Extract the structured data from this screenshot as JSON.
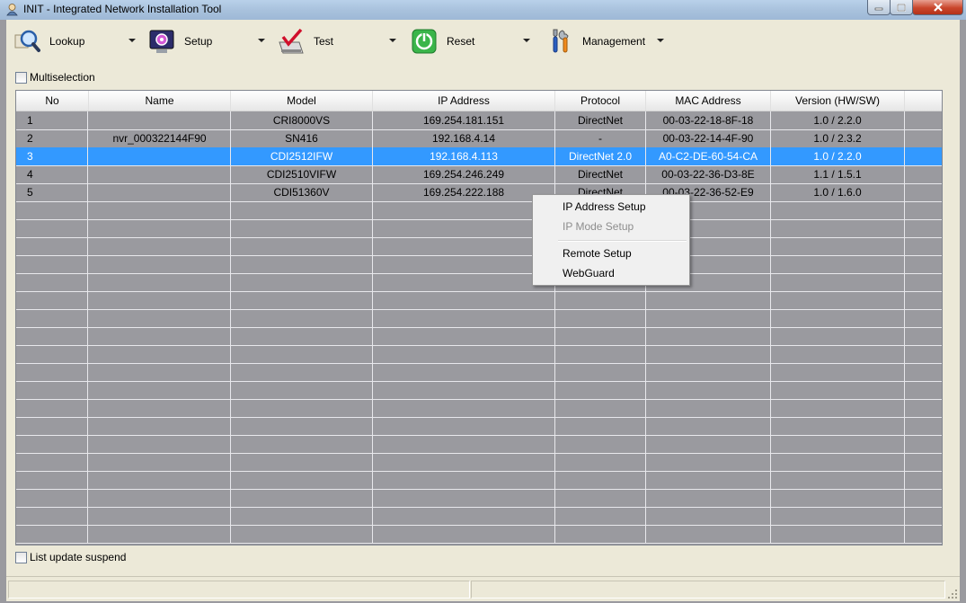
{
  "window": {
    "title": "INIT - Integrated Network Installation Tool"
  },
  "toolbar": {
    "items": [
      {
        "label": "Lookup",
        "icon": "magnifier-icon"
      },
      {
        "label": "Setup",
        "icon": "setup-gear-icon"
      },
      {
        "label": "Test",
        "icon": "test-check-icon"
      },
      {
        "label": "Reset",
        "icon": "power-icon"
      },
      {
        "label": "Management",
        "icon": "tools-icon"
      }
    ]
  },
  "multiselection": {
    "label": "Multiselection",
    "checked": false
  },
  "list_update": {
    "label": "List update suspend",
    "checked": false
  },
  "table": {
    "columns": [
      "No",
      "Name",
      "Model",
      "IP Address",
      "Protocol",
      "MAC Address",
      "Version (HW/SW)"
    ],
    "rows": [
      {
        "no": "1",
        "name": "",
        "model": "CRI8000VS",
        "ip": "169.254.181.151",
        "protocol": "DirectNet",
        "mac": "00-03-22-18-8F-18",
        "version": "1.0 / 2.2.0"
      },
      {
        "no": "2",
        "name": "nvr_000322144F90",
        "model": "SN416",
        "ip": "192.168.4.14",
        "protocol": "-",
        "mac": "00-03-22-14-4F-90",
        "version": "1.0 / 2.3.2"
      },
      {
        "no": "3",
        "name": "",
        "model": "CDI2512IFW",
        "ip": "192.168.4.113",
        "protocol": "DirectNet 2.0",
        "mac": "A0-C2-DE-60-54-CA",
        "version": "1.0 / 2.2.0"
      },
      {
        "no": "4",
        "name": "",
        "model": "CDI2510VIFW",
        "ip": "169.254.246.249",
        "protocol": "DirectNet",
        "mac": "00-03-22-36-D3-8E",
        "version": "1.1 / 1.5.1"
      },
      {
        "no": "5",
        "name": "",
        "model": "CDI51360V",
        "ip": "169.254.222.188",
        "protocol": "DirectNet",
        "mac": "00-03-22-36-52-E9",
        "version": "1.0 / 1.6.0"
      }
    ],
    "selected_row": 3
  },
  "context_menu": {
    "items": [
      {
        "label": "IP Address Setup",
        "enabled": true
      },
      {
        "label": "IP Mode Setup",
        "enabled": false
      },
      {
        "label": "Remote Setup",
        "enabled": true
      },
      {
        "label": "WebGuard",
        "enabled": true
      }
    ]
  },
  "colors": {
    "selection": "#3399ff",
    "grid_background": "#9a9a9f",
    "client_background": "#ece9d8",
    "close_button": "#c9462c"
  }
}
